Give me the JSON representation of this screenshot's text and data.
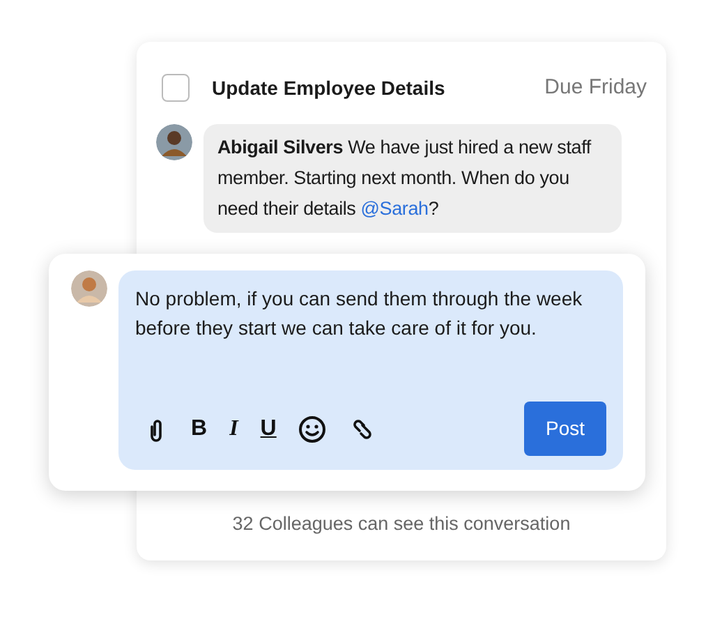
{
  "task": {
    "checked": false,
    "title": "Update Employee Details",
    "due": "Due Friday"
  },
  "comment": {
    "text": "**Abigail Silvers**  We have just hired a new staff member. Starting next month. When do you need their details ",
    "mention": "@Sarah",
    "suffix": "?"
  },
  "reply": {
    "value": "No problem, if you can send them through the week before they start we can take care of it for you.",
    "toolbar": [
      {
        "kind": "attach"
      },
      {
        "kind": "bold",
        "label": "B"
      },
      {
        "kind": "italic",
        "label": "I"
      },
      {
        "kind": "underline",
        "label": "U"
      },
      {
        "kind": "emoji"
      },
      {
        "kind": "link"
      }
    ],
    "button": "Post"
  },
  "footer": "32 Colleagues can see this conversation"
}
